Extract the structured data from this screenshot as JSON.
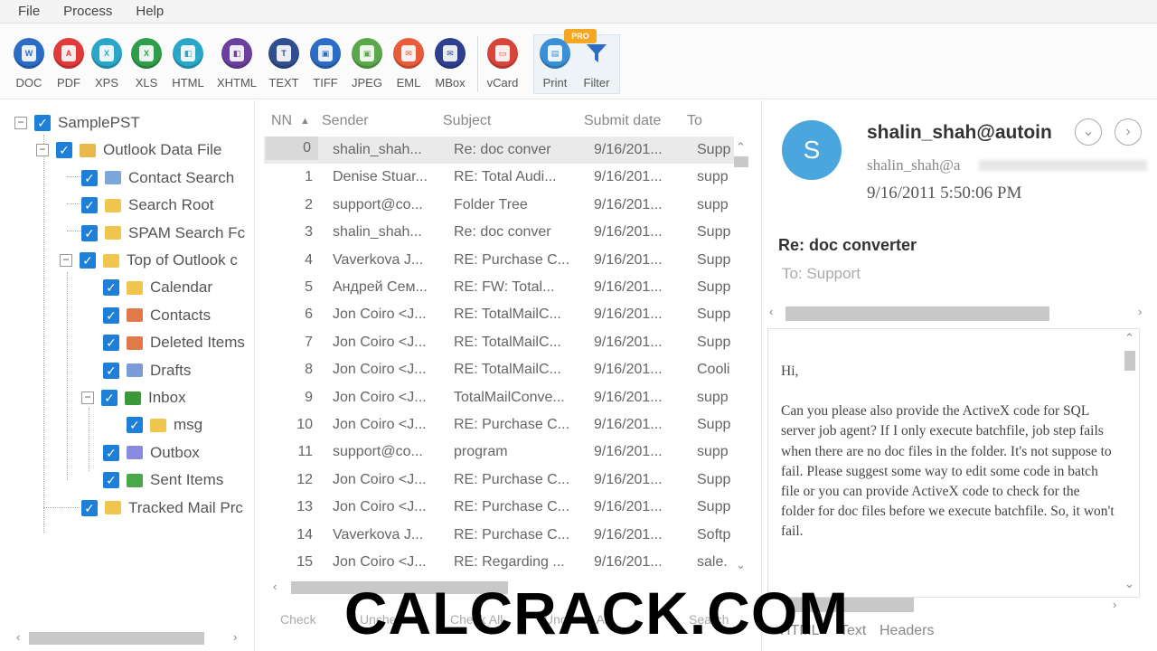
{
  "menu": [
    "File",
    "Process",
    "Help"
  ],
  "toolbar": {
    "buttons": [
      {
        "label": "DOC",
        "icon": "doc-icon",
        "color": "#2b6cc4",
        "glyph": "W"
      },
      {
        "label": "PDF",
        "icon": "pdf-icon",
        "color": "#e03a3a",
        "glyph": "A"
      },
      {
        "label": "XPS",
        "icon": "xps-icon",
        "color": "#2aa6c8",
        "glyph": "X"
      },
      {
        "label": "XLS",
        "icon": "xls-icon",
        "color": "#2e9e4a",
        "glyph": "X"
      },
      {
        "label": "HTML",
        "icon": "html-icon",
        "color": "#2aa6c8",
        "glyph": "◧"
      },
      {
        "label": "XHTML",
        "icon": "xhtml-icon",
        "color": "#6a3fa0",
        "glyph": "◧"
      },
      {
        "label": "TEXT",
        "icon": "text-icon",
        "color": "#2f4f8f",
        "glyph": "T"
      },
      {
        "label": "TIFF",
        "icon": "tiff-icon",
        "color": "#2b6cc4",
        "glyph": "▣"
      },
      {
        "label": "JPEG",
        "icon": "jpeg-icon",
        "color": "#5aa84a",
        "glyph": "▣"
      },
      {
        "label": "EML",
        "icon": "eml-icon",
        "color": "#e85c3a",
        "glyph": "✉"
      },
      {
        "label": "MBox",
        "icon": "mbox-icon",
        "color": "#2f3f8f",
        "glyph": "✉"
      },
      {
        "label": "vCard",
        "icon": "vcard-icon",
        "color": "#d9443a",
        "glyph": "▭"
      }
    ],
    "print_label": "Print",
    "filter_label": "Filter",
    "pro_badge": "PRO"
  },
  "tree": {
    "items": [
      {
        "label": "SamplePST",
        "icon": "pst-icon"
      },
      {
        "label": "Outlook Data File",
        "icon": "data-file-icon"
      },
      {
        "label": "Contact Search",
        "icon": "contact-search-icon"
      },
      {
        "label": "Search Root",
        "icon": "folder-icon"
      },
      {
        "label": "SPAM Search Fc",
        "icon": "folder-icon"
      },
      {
        "label": "Top of Outlook c",
        "icon": "folder-icon"
      },
      {
        "label": "Calendar",
        "icon": "folder-icon"
      },
      {
        "label": "Contacts",
        "icon": "contacts-icon"
      },
      {
        "label": "Deleted Items",
        "icon": "deleted-items-icon"
      },
      {
        "label": "Drafts",
        "icon": "drafts-icon"
      },
      {
        "label": "Inbox",
        "icon": "inbox-icon"
      },
      {
        "label": "msg",
        "icon": "folder-icon"
      },
      {
        "label": "Outbox",
        "icon": "outbox-icon"
      },
      {
        "label": "Sent Items",
        "icon": "sent-items-icon"
      },
      {
        "label": "Tracked Mail Prc",
        "icon": "folder-icon"
      }
    ]
  },
  "list": {
    "headers": {
      "nn": "NN",
      "sender": "Sender",
      "subject": "Subject",
      "date": "Submit date",
      "to": "To"
    },
    "rows": [
      {
        "nn": "0",
        "sender": "shalin_shah...",
        "subject": "Re: doc conver",
        "date": "9/16/201...",
        "to": "Supp"
      },
      {
        "nn": "1",
        "sender": "Denise Stuar...",
        "subject": "RE: Total Audi...",
        "date": "9/16/201...",
        "to": "supp"
      },
      {
        "nn": "2",
        "sender": "support@co...",
        "subject": "Folder Tree",
        "date": "9/16/201...",
        "to": "supp"
      },
      {
        "nn": "3",
        "sender": "shalin_shah...",
        "subject": "Re: doc conver",
        "date": "9/16/201...",
        "to": "Supp"
      },
      {
        "nn": "4",
        "sender": "Vaverkova J...",
        "subject": "RE: Purchase C...",
        "date": "9/16/201...",
        "to": "Supp"
      },
      {
        "nn": "5",
        "sender": "Андрей Сем...",
        "subject": "RE: FW: Total...",
        "date": "9/16/201...",
        "to": "Supp"
      },
      {
        "nn": "6",
        "sender": "Jon Coiro <J...",
        "subject": "RE: TotalMailC...",
        "date": "9/16/201...",
        "to": "Supp"
      },
      {
        "nn": "7",
        "sender": "Jon Coiro <J...",
        "subject": "RE: TotalMailC...",
        "date": "9/16/201...",
        "to": "Supp"
      },
      {
        "nn": "8",
        "sender": "Jon Coiro <J...",
        "subject": "RE: TotalMailC...",
        "date": "9/16/201...",
        "to": "Cooli"
      },
      {
        "nn": "9",
        "sender": "Jon Coiro <J...",
        "subject": "TotalMailConve...",
        "date": "9/16/201...",
        "to": "supp"
      },
      {
        "nn": "10",
        "sender": "Jon Coiro <J...",
        "subject": "RE: Purchase C...",
        "date": "9/16/201...",
        "to": "Supp"
      },
      {
        "nn": "11",
        "sender": "support@co...",
        "subject": "program",
        "date": "9/16/201...",
        "to": "supp"
      },
      {
        "nn": "12",
        "sender": "Jon Coiro <J...",
        "subject": "RE: Purchase C...",
        "date": "9/16/201...",
        "to": "Supp"
      },
      {
        "nn": "13",
        "sender": "Jon Coiro <J...",
        "subject": "RE: Purchase C...",
        "date": "9/16/201...",
        "to": "Supp"
      },
      {
        "nn": "14",
        "sender": "Vaverkova J...",
        "subject": "RE: Purchase C...",
        "date": "9/16/201...",
        "to": "Softp"
      },
      {
        "nn": "15",
        "sender": "Jon Coiro <J...",
        "subject": "RE: Regarding ...",
        "date": "9/16/201...",
        "to": "sale."
      }
    ],
    "bottom_items": [
      "Check",
      "Uncheck",
      "Check All",
      "Uncheck All",
      "Search"
    ]
  },
  "preview": {
    "avatar_letter": "S",
    "from": "shalin_shah@autoin",
    "address": "shalin_shah@a",
    "date": "9/16/2011 5:50:06 PM",
    "subject": "Re: doc converter",
    "to": "To: Support",
    "body": [
      "Hi,",
      "Can you please also provide the ActiveX code for SQL server job agent? If I only execute batchfile, job step fails when there are no doc files in the folder. It's not suppose to fail. Please suggest some way to edit some code in batch file or you can provide ActiveX code to check for the folder for doc files before we execute batchfile. So, it won't fail."
    ],
    "tabs": [
      "HTML",
      "Text",
      "Headers"
    ]
  },
  "watermark": "CALCRACK.COM"
}
